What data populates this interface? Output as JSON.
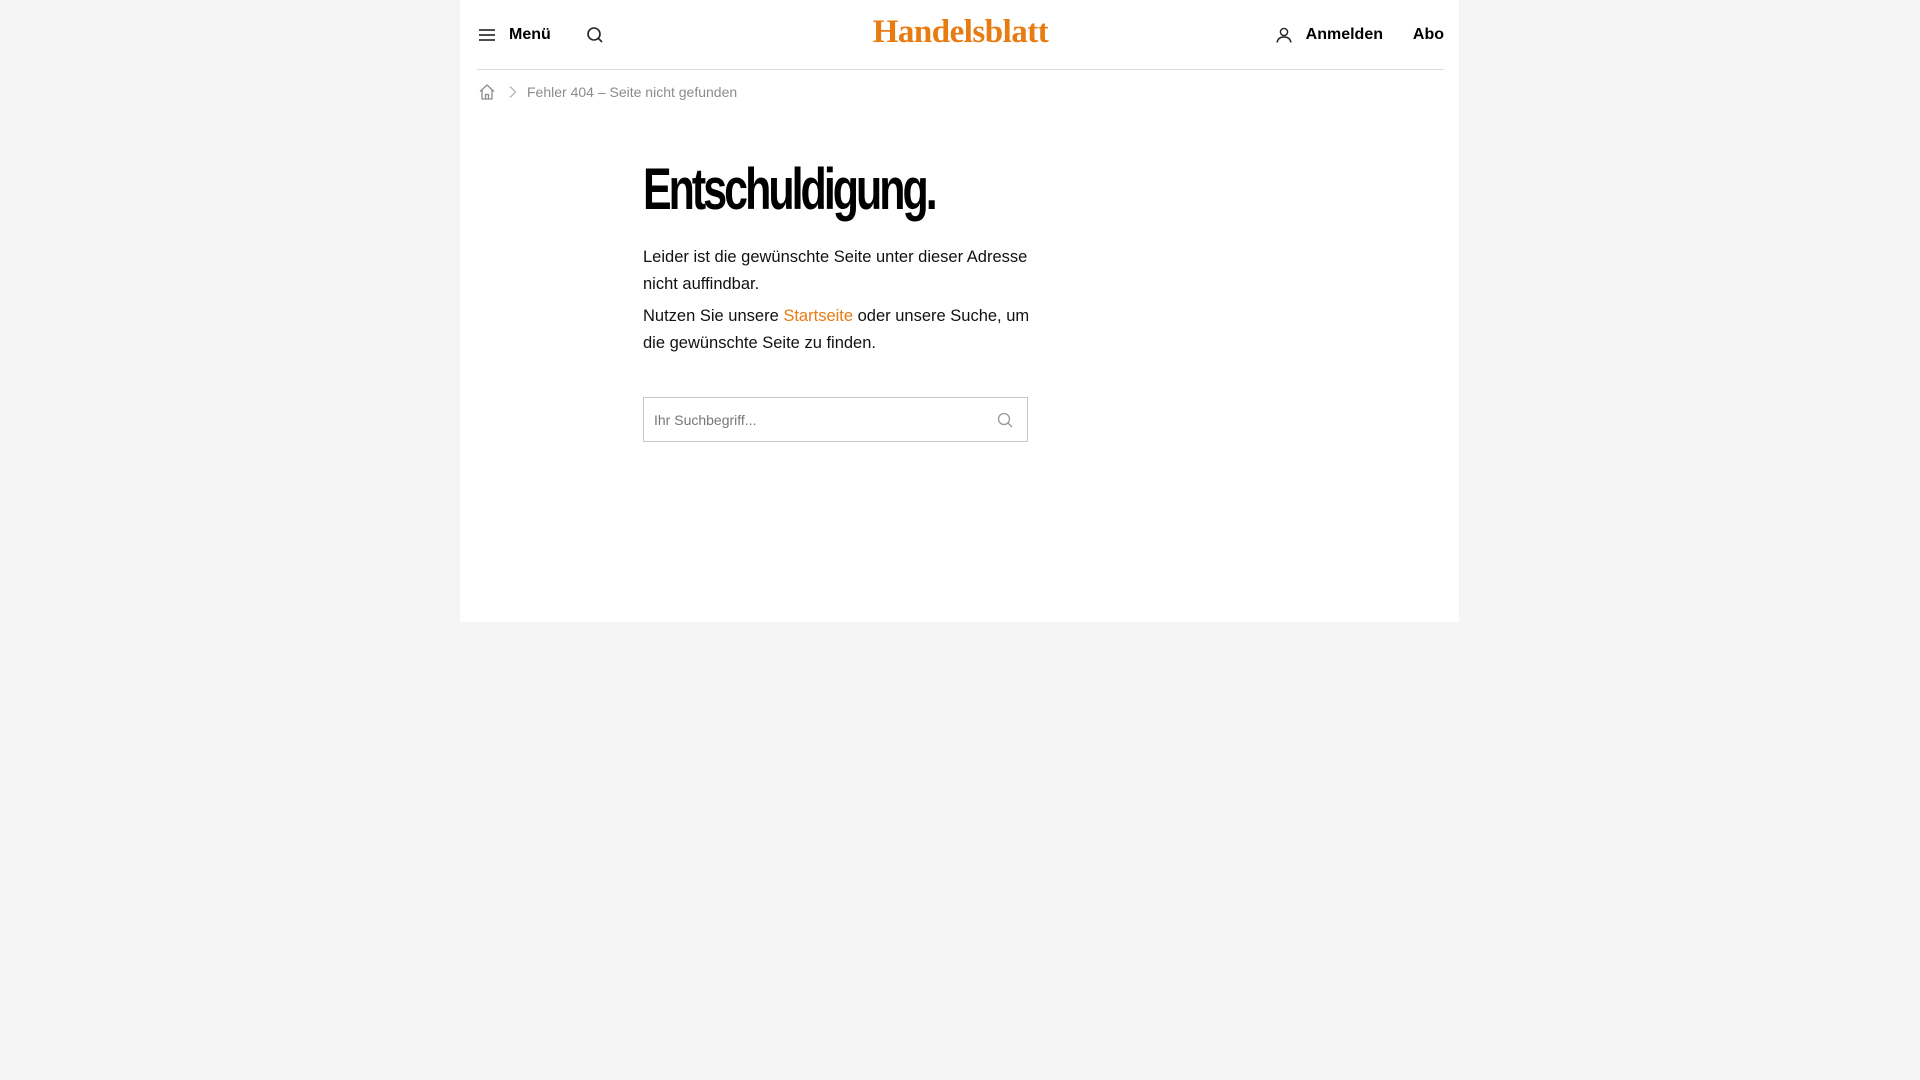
{
  "header": {
    "menu_label": "Menü",
    "menu_icon": "hamburger-icon",
    "search_icon": "search-icon",
    "logo_text": "Handelsblatt",
    "login_label": "Anmelden",
    "login_icon": "user-icon",
    "abo_label": "Abo"
  },
  "breadcrumb": {
    "home_icon": "home-icon",
    "separator_icon": "chevron-right-icon",
    "current": "Fehler 404 – Seite nicht gefunden"
  },
  "main": {
    "headline": "Entschuldigung.",
    "paragraph1": "Leider ist die gewünschte Seite unter dieser Adresse nicht auffindbar.",
    "paragraph2_before": "Nutzen Sie unsere ",
    "paragraph2_link": "Startseite",
    "paragraph2_after": " oder unsere Suche, um die gewünschte Seite zu finden.",
    "search": {
      "placeholder": "Ihr Suchbegriff...",
      "value": ""
    }
  },
  "colors": {
    "brand": "#e97b13",
    "page_background": "#f5f5f5",
    "content_background": "#ffffff",
    "breadcrumb_text": "#8c8c8c"
  }
}
